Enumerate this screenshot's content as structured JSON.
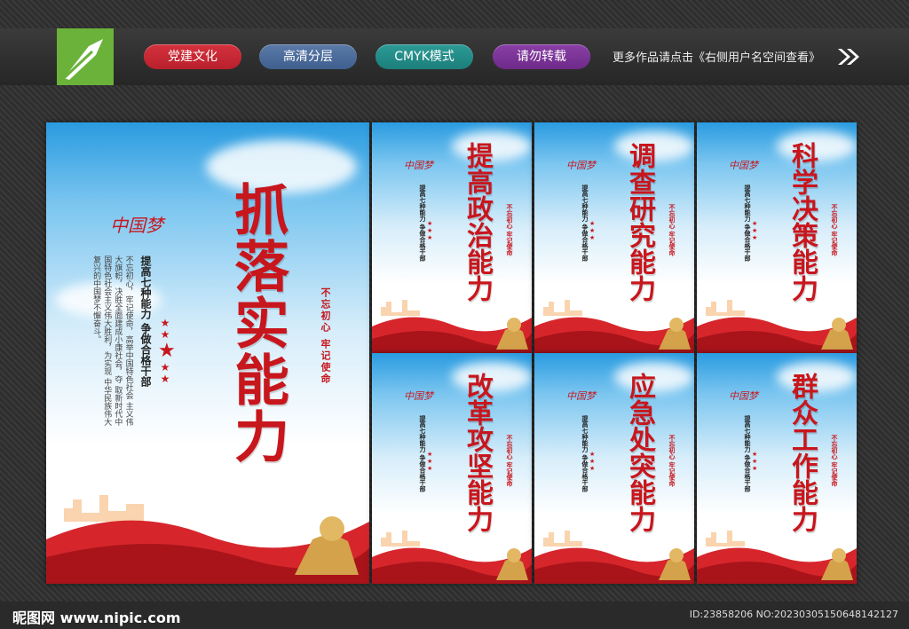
{
  "header": {
    "tags": [
      "党建文化",
      "高清分层",
      "CMYK模式",
      "请勿转载"
    ],
    "hint": "更多作品请点击《右侧用户名空间查看》",
    "logo_icon": "pen-nib-icon",
    "arrow_icon": "double-chevron-right-icon"
  },
  "main_poster": {
    "title": "抓落实能力",
    "dream": "中国梦",
    "subtitle": "提高七种能力 争做合格干部",
    "seal": "不忘初心 牢记使命",
    "body_cols": [
      "不忘初心，牢记使命，高举中国特色社会",
      "主义伟大旗帜，决胜全面建成小康社会，夺",
      "取新时代中国特色社会主义伟大胜利，为实现",
      "中华民族伟大复兴的中国梦不懈奋斗。"
    ]
  },
  "small_posters": [
    {
      "title": "提高政治能力"
    },
    {
      "title": "调查研究能力"
    },
    {
      "title": "科学决策能力"
    },
    {
      "title": "改革攻坚能力"
    },
    {
      "title": "应急处突能力"
    },
    {
      "title": "群众工作能力"
    }
  ],
  "small_common": {
    "dream": "中国梦",
    "subtitle": "提高七种能力 争做合格干部",
    "seal": "不忘初心 牢记使命"
  },
  "footer": {
    "site": "昵图网 www.nipic.com",
    "id": "ID:23858206 NO:20230305150648142127"
  },
  "colors": {
    "accent_red": "#c8161d",
    "logo_green": "#6bb23a"
  }
}
